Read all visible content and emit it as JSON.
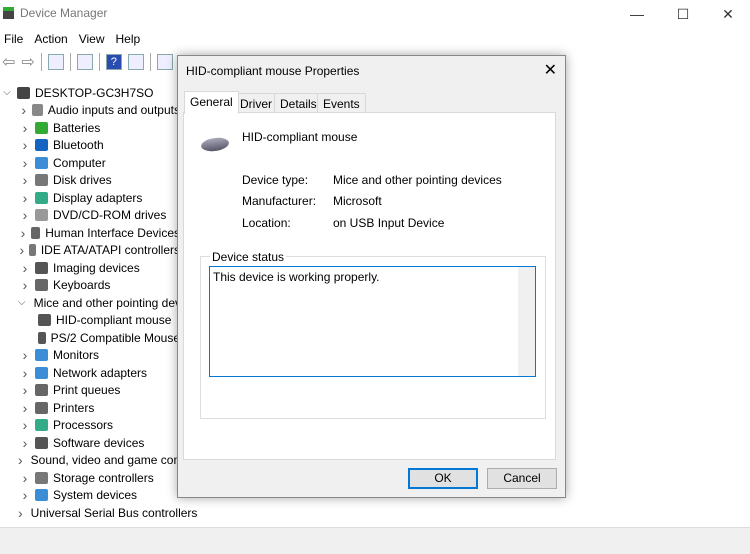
{
  "window": {
    "title": "Device Manager",
    "minimize": "—",
    "maximize": "☐",
    "close": "✕"
  },
  "menu": [
    "File",
    "Action",
    "View",
    "Help"
  ],
  "toolbar": [
    "back",
    "forward",
    "show-hide",
    "properties",
    "help",
    "update-driver",
    "scan"
  ],
  "tree": {
    "root": "DESKTOP-GC3H7SO",
    "items": [
      {
        "label": "Audio inputs and outputs",
        "color": "#888"
      },
      {
        "label": "Batteries",
        "color": "#3a3"
      },
      {
        "label": "Bluetooth",
        "color": "#1565c0"
      },
      {
        "label": "Computer",
        "color": "#3b8ed6"
      },
      {
        "label": "Disk drives",
        "color": "#777"
      },
      {
        "label": "Display adapters",
        "color": "#3a8"
      },
      {
        "label": "DVD/CD-ROM drives",
        "color": "#999"
      },
      {
        "label": "Human Interface Devices",
        "color": "#666"
      },
      {
        "label": "IDE ATA/ATAPI controllers",
        "color": "#777"
      },
      {
        "label": "Imaging devices",
        "color": "#555"
      },
      {
        "label": "Keyboards",
        "color": "#666"
      },
      {
        "label": "Mice and other pointing devices",
        "color": "#555",
        "expanded": true
      },
      {
        "label": "HID-compliant mouse",
        "color": "#555",
        "child": true
      },
      {
        "label": "PS/2 Compatible Mouse",
        "color": "#555",
        "child": true
      },
      {
        "label": "Monitors",
        "color": "#3b8ed6"
      },
      {
        "label": "Network adapters",
        "color": "#3b8ed6"
      },
      {
        "label": "Print queues",
        "color": "#666"
      },
      {
        "label": "Printers",
        "color": "#666"
      },
      {
        "label": "Processors",
        "color": "#3a8"
      },
      {
        "label": "Software devices",
        "color": "#555"
      },
      {
        "label": "Sound, video and game controllers",
        "color": "#888"
      },
      {
        "label": "Storage controllers",
        "color": "#777"
      },
      {
        "label": "System devices",
        "color": "#3b8ed6"
      },
      {
        "label": "Universal Serial Bus controllers",
        "color": "#555"
      }
    ]
  },
  "dialog": {
    "title": "HID-compliant mouse Properties",
    "tabs": [
      "General",
      "Driver",
      "Details",
      "Events"
    ],
    "device_name": "HID-compliant mouse",
    "fields": [
      {
        "label": "Device type:",
        "value": "Mice and other pointing devices"
      },
      {
        "label": "Manufacturer:",
        "value": "Microsoft"
      },
      {
        "label": "Location:",
        "value": "on USB Input Device"
      }
    ],
    "status_label": "Device status",
    "status_text": "This device is working properly.",
    "ok": "OK",
    "cancel": "Cancel"
  }
}
